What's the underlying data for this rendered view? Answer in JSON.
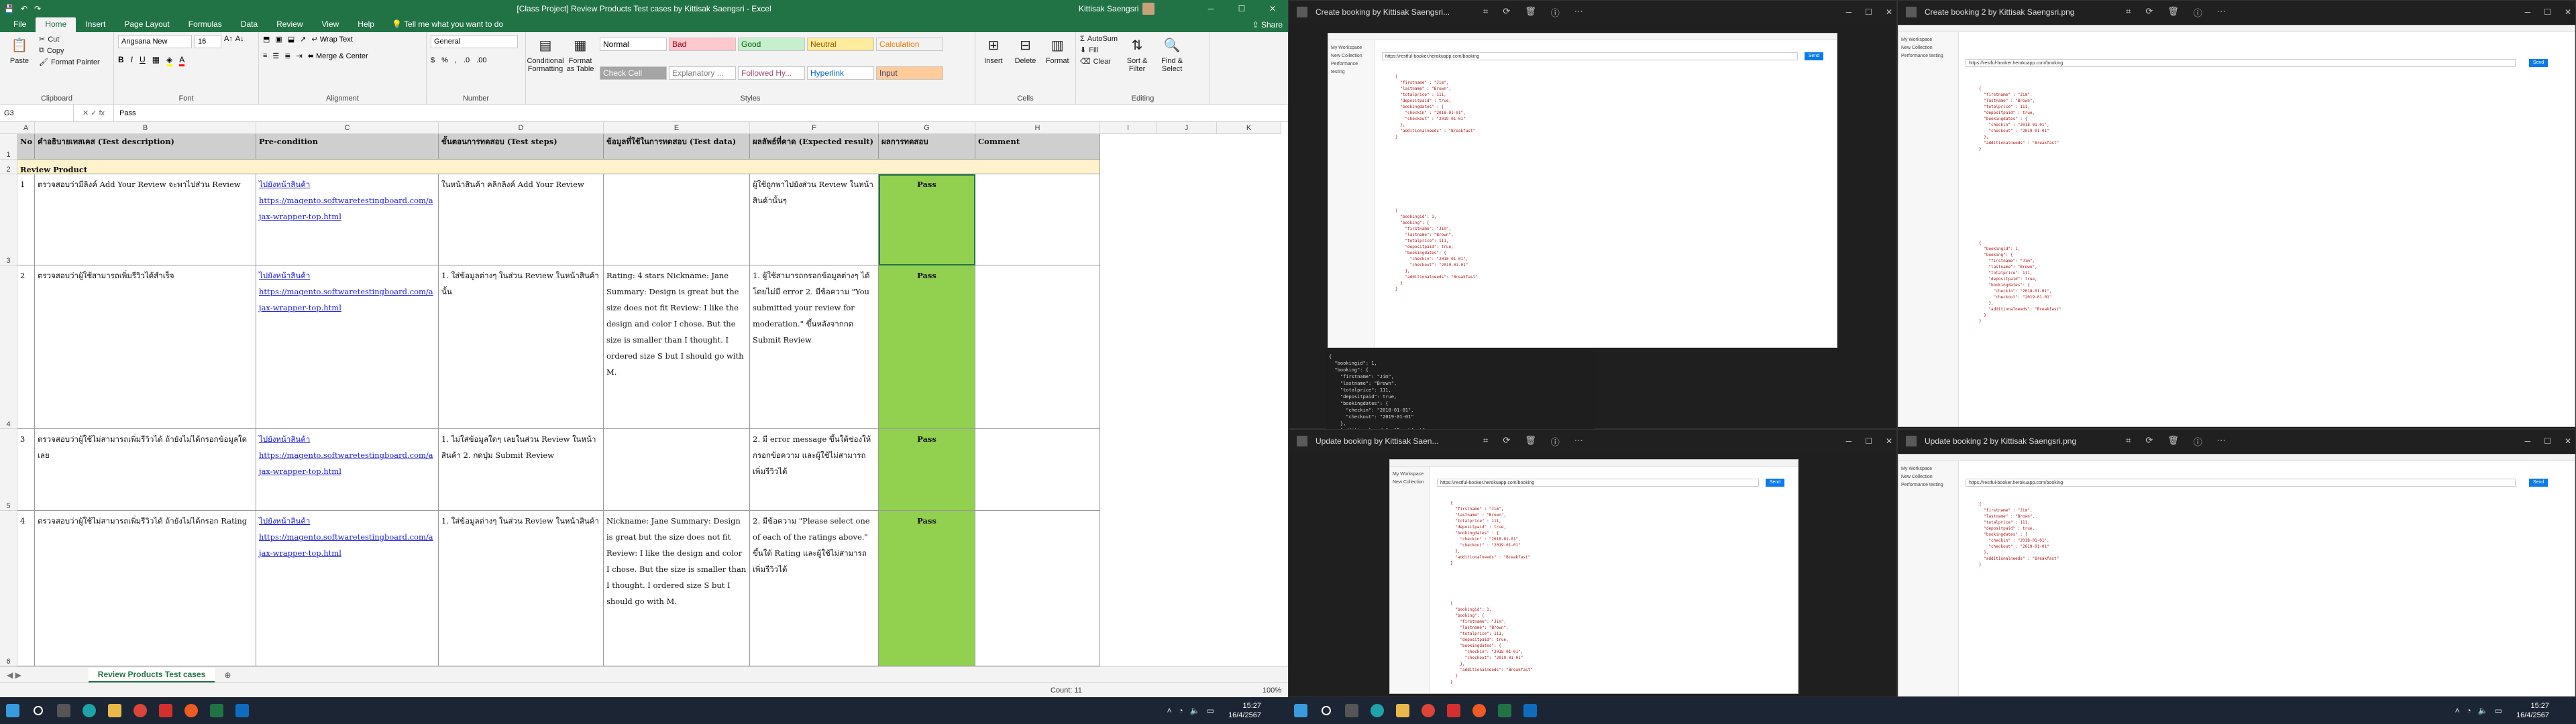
{
  "excel": {
    "title": "[Class Project] Review Products Test cases by Kittisak Saengsri  -  Excel",
    "user": "Kittisak Saengsri",
    "tabs": [
      "File",
      "Home",
      "Insert",
      "Page Layout",
      "Formulas",
      "Data",
      "Review",
      "View",
      "Help"
    ],
    "active_tab": "Home",
    "tell_me": "Tell me what you want to do",
    "share": "Share",
    "ribbon": {
      "clipboard": {
        "label": "Clipboard",
        "paste": "Paste",
        "cut": "Cut",
        "copy": "Copy",
        "format_painter": "Format Painter"
      },
      "font": {
        "label": "Font",
        "family": "Angsana New",
        "size": "16"
      },
      "alignment": {
        "label": "Alignment",
        "wrap": "Wrap Text",
        "merge": "Merge & Center"
      },
      "number": {
        "label": "Number",
        "format": "General"
      },
      "styles": {
        "label": "Styles",
        "conditional": "Conditional Formatting",
        "format_table": "Format as Table",
        "items": [
          {
            "t": "Normal",
            "bg": "#ffffff",
            "c": "#000000"
          },
          {
            "t": "Bad",
            "bg": "#ffc7ce",
            "c": "#9c0006"
          },
          {
            "t": "Good",
            "bg": "#c6efce",
            "c": "#006100"
          },
          {
            "t": "Neutral",
            "bg": "#ffeb9c",
            "c": "#9c5700"
          },
          {
            "t": "Calculation",
            "bg": "#f2f2f2",
            "c": "#fa7d00"
          },
          {
            "t": "Check Cell",
            "bg": "#a5a5a5",
            "c": "#ffffff"
          },
          {
            "t": "Explanatory ...",
            "bg": "#ffffff",
            "c": "#7f7f7f"
          },
          {
            "t": "Followed Hy...",
            "bg": "#ffffff",
            "c": "#954f72"
          },
          {
            "t": "Hyperlink",
            "bg": "#ffffff",
            "c": "#0563c1"
          },
          {
            "t": "Input",
            "bg": "#ffcc99",
            "c": "#3f3f76"
          }
        ]
      },
      "cells": {
        "label": "Cells",
        "insert": "Insert",
        "delete": "Delete",
        "format": "Format"
      },
      "editing": {
        "label": "Editing",
        "autosum": "AutoSum",
        "fill": "Fill",
        "clear": "Clear",
        "sort": "Sort & Filter",
        "find": "Find & Select"
      }
    },
    "name_box": "G3",
    "formula": "Pass",
    "columns": [
      "A",
      "B",
      "C",
      "D",
      "E",
      "F",
      "G",
      "H",
      "I",
      "J",
      "K"
    ],
    "headers": [
      "No",
      "คำอธิบายเทสเคส (Test description)",
      "Pre-condition",
      "ขั้นตอนการทดสอบ (Test steps)",
      "ข้อมูลที่ใช้ในการทดสอบ (Test data)",
      "ผลลัพธ์ที่คาด (Expected result)",
      "ผลการทดสอบ",
      "Comment",
      "H"
    ],
    "section": "Review Product",
    "rows": [
      {
        "no": "1",
        "desc": "ตรวจสอบว่ามีลิงค์ Add Your Review จะพาไปส่วน Review",
        "pre_label": "ไปยังหน้าสินค้า",
        "pre_link": "https://magento.softwaretestingboard.com/ajax-wrapper-top.html",
        "steps": "ในหน้าสินค้า คลิกลิงค์ Add Your Review",
        "data": "",
        "expected": "ผู้ใช้ถูกพาไปยังส่วน Review ในหน้าสินค้านั้นๆ",
        "result": "Pass"
      },
      {
        "no": "2",
        "desc": "ตรวจสอบว่าผู้ใช้สามารถเพิ่มรีวิวได้สำเร็จ",
        "pre_label": "ไปยังหน้าสินค้า",
        "pre_link": "https://magento.softwaretestingboard.com/ajax-wrapper-top.html",
        "steps": "1. ใส่ข้อมูลต่างๆ ในส่วน Review ในหน้าสินค้านั้น",
        "data": "Rating: 4 stars Nickname: Jane Summary: Design is great but the size does not fit Review: I like the design and color I chose. But the size is smaller than I thought. I ordered size S but I should go with M.",
        "expected": "1. ผู้ใช้สามารถกรอกข้อมูลต่างๆ ได้โดยไม่มี error 2. มีข้อความ \"You submitted your review for moderation.\" ขึ้นหลังจากกด Submit Review",
        "result": "Pass"
      },
      {
        "no": "3",
        "desc": "ตรวจสอบว่าผู้ใช้ไม่สามารถเพิ่มรีวิวได้ ถ้ายังไม่ได้กรอกข้อมูลใดเลย",
        "pre_label": "ไปยังหน้าสินค้า",
        "pre_link": "https://magento.softwaretestingboard.com/ajax-wrapper-top.html",
        "steps": "1. ไม่ใส่ข้อมูลใดๆ เลยในส่วน Review ในหน้าสินค้า 2. กดปุ่ม Submit Review",
        "data": "",
        "expected": "2. มี error message ขึ้นใต้ช่องให้กรอกข้อความ และผู้ใช้ไม่สามารถเพิ่มรีวิวได้",
        "result": "Pass"
      },
      {
        "no": "4",
        "desc": "ตรวจสอบว่าผู้ใช้ไม่สามารถเพิ่มรีวิวได้ ถ้ายังไม่ได้กรอก Rating",
        "pre_label": "ไปยังหน้าสินค้า",
        "pre_link": "https://magento.softwaretestingboard.com/ajax-wrapper-top.html",
        "steps": "1. ใส่ข้อมูลต่างๆ ในส่วน Review ในหน้าสินค้า",
        "data": "Nickname: Jane Summary: Design is great but the size does not fit Review: I like the design and color I chose. But the size is smaller than I thought. I ordered size S but I should go with M.",
        "expected": "2. มีข้อความ \"Please select one of each of the ratings above.\" ขึ้นใต้ Rating และผู้ใช้ไม่สามารถเพิ่มรีวิวได้",
        "result": "Pass"
      }
    ],
    "sheet_tab": "Review Products Test cases",
    "status_count": "Count: 11",
    "zoom": "100%"
  },
  "snaps": [
    {
      "title": "Create booking by Kittisak Saengsri..."
    },
    {
      "title": "Create booking 2 by Kittisak Saengsri.png"
    },
    {
      "title": "Update booking by Kittisak Saen..."
    },
    {
      "title": "Update booking 2 by Kittisak Saengsri.png"
    }
  ],
  "postman": {
    "url": "https://restful-booker.herokuapp.com/booking",
    "send": "Send",
    "sidebar": [
      "My Workspace",
      "New Collection",
      "Performance testing"
    ],
    "body": "{\n  \"firstname\" : \"Jim\",\n  \"lastname\" : \"Brown\",\n  \"totalprice\" : 111,\n  \"depositpaid\" : true,\n  \"bookingdates\" : {\n    \"checkin\" : \"2018-01-01\",\n    \"checkout\" : \"2019-01-01\"\n  },\n  \"additionalneeds\" : \"Breakfast\"\n}",
    "response": "{\n  \"bookingid\": 1,\n  \"booking\": {\n    \"firstname\": \"Jim\",\n    \"lastname\": \"Brown\",\n    \"totalprice\": 111,\n    \"depositpaid\": true,\n    \"bookingdates\": {\n      \"checkin\": \"2018-01-01\",\n      \"checkout\": \"2019-01-01\"\n    },\n    \"additionalneeds\": \"Breakfast\"\n  }\n}"
  },
  "taskbar": {
    "time": "15:27",
    "date": "16/4/2567"
  }
}
